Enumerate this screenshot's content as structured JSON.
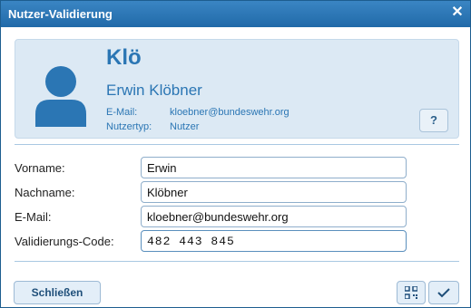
{
  "window": {
    "title": "Nutzer-Validierung",
    "close_icon": "close-icon"
  },
  "profile": {
    "username": "Klö",
    "fullname": "Erwin Klöbner",
    "email_label": "E-Mail:",
    "email_value": "kloebner@bundeswehr.org",
    "type_label": "Nutzertyp:",
    "type_value": "Nutzer",
    "help_label": "?"
  },
  "form": {
    "vorname_label": "Vorname:",
    "vorname_value": "Erwin",
    "nachname_label": "Nachname:",
    "nachname_value": "Klöbner",
    "email_label": "E-Mail:",
    "email_value": "kloebner@bundeswehr.org",
    "code_label": "Validierungs-Code:",
    "code_value": "482 443 845"
  },
  "footer": {
    "close_label": "Schließen",
    "qr_icon": "qr-code-icon",
    "confirm_icon": "checkmark-icon"
  },
  "colors": {
    "titlebar": "#2a73b2",
    "accent": "#2b76b4",
    "card_bg": "#dce9f4"
  }
}
